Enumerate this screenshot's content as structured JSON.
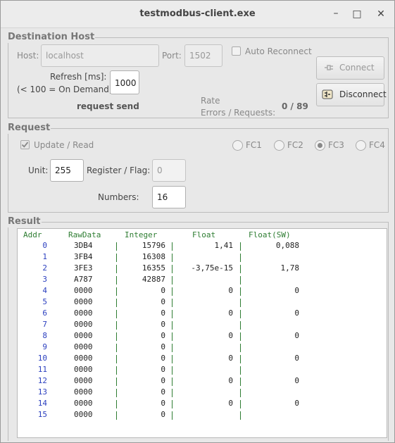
{
  "window": {
    "title": "testmodbus-client.exe",
    "minimize": "–",
    "maximize": "□",
    "close": "✕"
  },
  "destination": {
    "group_label": "Destination Host",
    "host_label": "Host:",
    "host_value": "localhost",
    "port_label": "Port:",
    "port_value": "1502",
    "auto_reconnect_label": "Auto Reconnect",
    "refresh_label": "Refresh [ms]:",
    "refresh_note": "(< 100 = On Demand)",
    "refresh_value": "1000",
    "connect_label": "Connect",
    "disconnect_label": "Disconnect",
    "status": "request send",
    "rate_label": "Rate",
    "errors_label": "Errors / Requests:",
    "errors_value": "0 / 89"
  },
  "request": {
    "group_label": "Request",
    "update_read_label": "Update / Read",
    "fc_options": [
      "FC1",
      "FC2",
      "FC3",
      "FC4"
    ],
    "fc_selected": "FC3",
    "unit_label": "Unit:",
    "unit_value": "255",
    "register_label": "Register / Flag:",
    "register_value": "0",
    "numbers_label": "Numbers:",
    "numbers_value": "16"
  },
  "result": {
    "group_label": "Result",
    "columns": [
      "Addr",
      "RawData",
      "Integer",
      "Float",
      "Float(SW)"
    ],
    "rows": [
      {
        "addr": "0",
        "raw": "3DB4",
        "int": "15796",
        "float": "1,41",
        "float_sw": "0,088"
      },
      {
        "addr": "1",
        "raw": "3FB4",
        "int": "16308",
        "float": "",
        "float_sw": ""
      },
      {
        "addr": "2",
        "raw": "3FE3",
        "int": "16355",
        "float": "-3,75e-15",
        "float_sw": "1,78"
      },
      {
        "addr": "3",
        "raw": "A787",
        "int": "42887",
        "float": "",
        "float_sw": ""
      },
      {
        "addr": "4",
        "raw": "0000",
        "int": "0",
        "float": "0",
        "float_sw": "0"
      },
      {
        "addr": "5",
        "raw": "0000",
        "int": "0",
        "float": "",
        "float_sw": ""
      },
      {
        "addr": "6",
        "raw": "0000",
        "int": "0",
        "float": "0",
        "float_sw": "0"
      },
      {
        "addr": "7",
        "raw": "0000",
        "int": "0",
        "float": "",
        "float_sw": ""
      },
      {
        "addr": "8",
        "raw": "0000",
        "int": "0",
        "float": "0",
        "float_sw": "0"
      },
      {
        "addr": "9",
        "raw": "0000",
        "int": "0",
        "float": "",
        "float_sw": ""
      },
      {
        "addr": "10",
        "raw": "0000",
        "int": "0",
        "float": "0",
        "float_sw": "0"
      },
      {
        "addr": "11",
        "raw": "0000",
        "int": "0",
        "float": "",
        "float_sw": ""
      },
      {
        "addr": "12",
        "raw": "0000",
        "int": "0",
        "float": "0",
        "float_sw": "0"
      },
      {
        "addr": "13",
        "raw": "0000",
        "int": "0",
        "float": "",
        "float_sw": ""
      },
      {
        "addr": "14",
        "raw": "0000",
        "int": "0",
        "float": "0",
        "float_sw": "0"
      },
      {
        "addr": "15",
        "raw": "0000",
        "int": "0",
        "float": "",
        "float_sw": ""
      }
    ]
  },
  "icons": {
    "connect": "plug-icon",
    "disconnect": "unplug-icon",
    "checkbox_checked": "checkmark-icon"
  },
  "colors": {
    "header_green": "#2e7d32",
    "addr_blue": "#2b3fbf"
  }
}
